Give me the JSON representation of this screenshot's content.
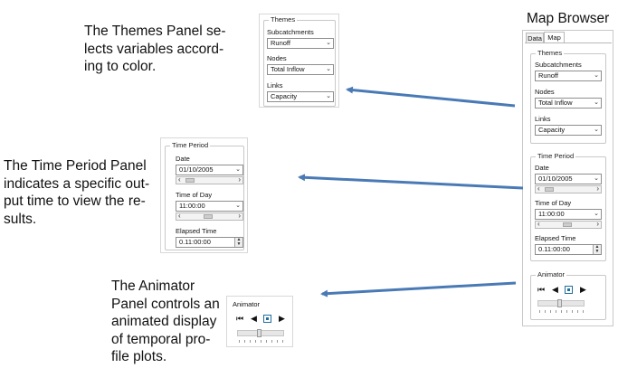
{
  "captions": {
    "themes": [
      "The Themes Panel se-",
      "lects variables accord-",
      "ing to color."
    ],
    "time_period": [
      "The Time Period Panel",
      "indicates a specific out-",
      "put time to view the re-",
      "sults."
    ],
    "animator": [
      "The Animator",
      "Panel controls an",
      "animated display",
      "of temporal pro-",
      "file plots."
    ]
  },
  "map_browser_title": "Map Browser",
  "tabs": [
    "Data",
    "Map"
  ],
  "themes": {
    "title": "Themes",
    "subcatchments_label": "Subcatchments",
    "subcatchments_value": "Runoff",
    "nodes_label": "Nodes",
    "nodes_value": "Total Inflow",
    "links_label": "Links",
    "links_value": "Capacity"
  },
  "time_period": {
    "title": "Time Period",
    "date_label": "Date",
    "date_value": "01/10/2005",
    "time_label": "Time of Day",
    "time_value": "11:00:00",
    "elapsed_label": "Elapsed Time",
    "elapsed_value": "0.11:00:00"
  },
  "animator": {
    "title": "Animator",
    "slider_level": 0.45
  },
  "colors": {
    "arrow": "#4a7ab5",
    "stop_button": "#1f6fa0"
  },
  "icons": [
    "chevron-down-icon",
    "arrow-left-icon",
    "arrow-right-icon",
    "rewind-icon",
    "step-back-icon",
    "stop-icon",
    "play-icon",
    "spin-up-icon",
    "spin-down-icon"
  ]
}
